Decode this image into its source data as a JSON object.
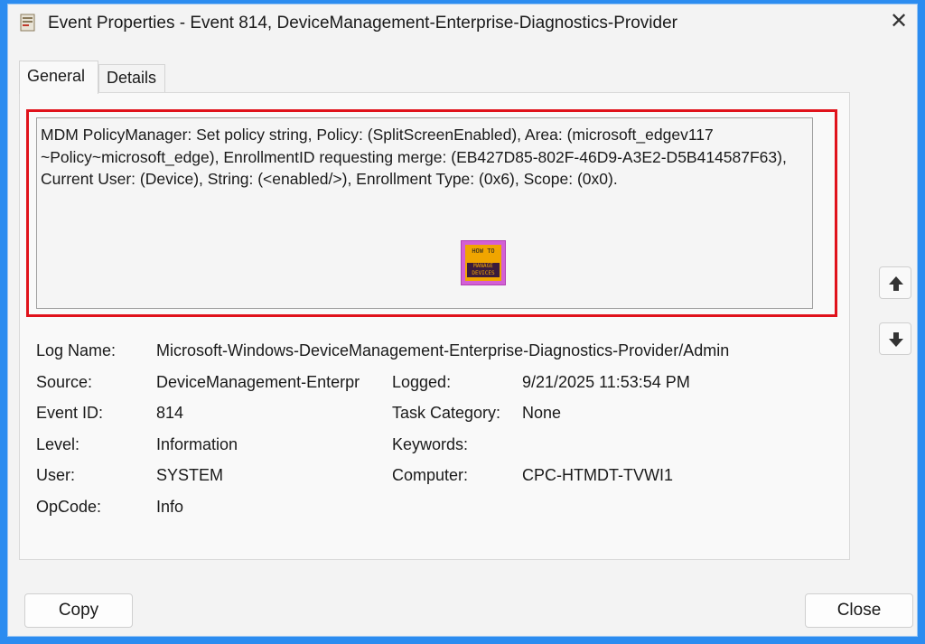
{
  "window": {
    "title": "Event Properties - Event 814, DeviceManagement-Enterprise-Diagnostics-Provider",
    "close_glyph": "✕"
  },
  "tabs": [
    {
      "label": "General",
      "active": true
    },
    {
      "label": "Details",
      "active": false
    }
  ],
  "description": "MDM PolicyManager: Set policy string, Policy: (SplitScreenEnabled), Area: (microsoft_edgev117 ~Policy~microsoft_edge), EnrollmentID requesting merge: (EB427D85-802F-46D9-A3E2-D5B414587F63), Current User: (Device), String: (<enabled/>), Enrollment Type: (0x6), Scope: (0x0).",
  "logo": {
    "line1": "HOW TO",
    "line2": "MANAGE DEVICES"
  },
  "fields": {
    "log_name_label": "Log Name:",
    "log_name_value": "Microsoft-Windows-DeviceManagement-Enterprise-Diagnostics-Provider/Admin",
    "source_label": "Source:",
    "source_value": "DeviceManagement-Enterpr",
    "logged_label": "Logged:",
    "logged_value": "9/21/2025 11:53:54 PM",
    "event_id_label": "Event ID:",
    "event_id_value": "814",
    "task_category_label": "Task Category:",
    "task_category_value": "None",
    "level_label": "Level:",
    "level_value": "Information",
    "keywords_label": "Keywords:",
    "keywords_value": "",
    "user_label": "User:",
    "user_value": "SYSTEM",
    "computer_label": "Computer:",
    "computer_value": "CPC-HTMDT-TVWI1",
    "opcode_label": "OpCode:",
    "opcode_value": "Info"
  },
  "buttons": {
    "copy": "Copy",
    "close": "Close"
  },
  "icons": {
    "app": "event-viewer-icon",
    "up": "arrow-up-icon",
    "down": "arrow-down-icon",
    "close": "close-icon"
  },
  "colors": {
    "background": "#2b8cf0",
    "highlight": "#e0121b",
    "window": "#f3f3f3"
  }
}
